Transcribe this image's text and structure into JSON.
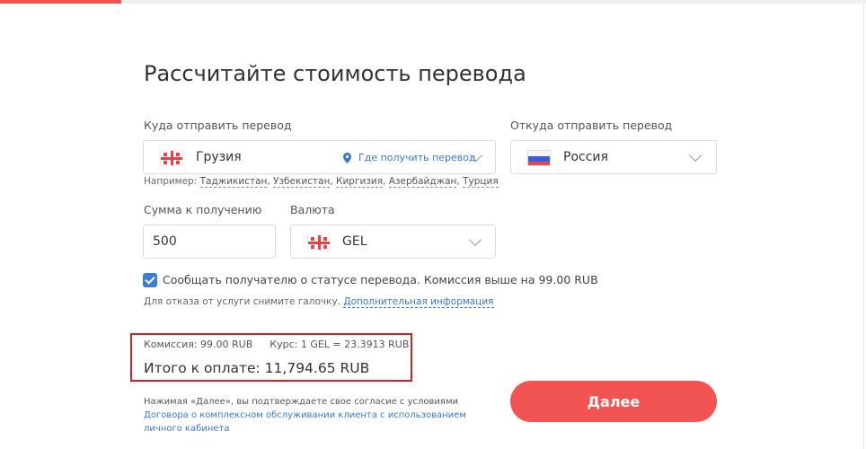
{
  "title": "Рассчитайте стоимость перевода",
  "destination": {
    "label": "Куда отправить перевод",
    "country": "Грузия",
    "flag_icon": "georgia-flag-icon",
    "where_link": "Где получить перевод",
    "examples_prefix": "Например:",
    "examples": [
      "Таджикистан",
      "Узбекистан",
      "Киргизия",
      "Азербайджан",
      "Турция"
    ]
  },
  "origin": {
    "label": "Откуда отправить перевод",
    "country": "Россия",
    "flag_icon": "russia-flag-icon"
  },
  "amount": {
    "label": "Сумма к получению",
    "value": "500"
  },
  "currency": {
    "label": "Валюта",
    "value": "GEL",
    "flag_icon": "georgia-flag-icon"
  },
  "notify": {
    "checked": true,
    "text": "Сообщать получателю о статусе перевода. Комиссия выше на 99.00 RUB",
    "refuse_text": "Для отказа от услуги снимите галочку.",
    "info_link": "Дополнительная информация"
  },
  "summary": {
    "fee": "Комиссия: 99.00 RUB",
    "rate": "Курс: 1 GEL = 23.3913 RUB",
    "total": "Итого к оплате: 11,794.65 RUB"
  },
  "terms": {
    "text": "Нажимая «Далее», вы подтверждаете свое согласие с условиями",
    "link": "Договора о комплексном обслуживании клиента с использованием личного кабинета"
  },
  "next_button": "Далее",
  "colors": {
    "accent": "#f25454",
    "link": "#3a78c9",
    "highlight_border": "#d61f26",
    "checkbox": "#3d7bd4"
  }
}
